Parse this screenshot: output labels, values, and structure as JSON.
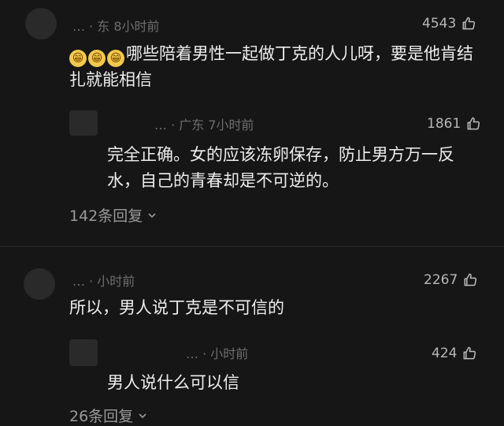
{
  "comments": [
    {
      "meta": "… · 东 8小时前",
      "likes": "4543",
      "emoji_prefix": [
        "😁",
        "😁",
        "😁"
      ],
      "text": "哪些陪着男性一起做丁克的人儿呀，要是他肯结扎就能相信"
    },
    {
      "meta": "… · 广东 7小时前",
      "likes": "1861",
      "text": "完全正确。女的应该冻卵保存，防止男方万一反水，自己的青春却是不可逆的。",
      "replies": "142条回复"
    },
    {
      "meta": "… · 小时前",
      "likes": "2267",
      "text": "所以，男人说丁克是不可信的"
    },
    {
      "meta": "… · 小时前",
      "likes": "424",
      "text": "男人说什么可以信",
      "replies": "26条回复"
    }
  ],
  "icons": {
    "like": "thumbs-up-icon",
    "expand": "chevron-down-icon"
  },
  "colors": {
    "background": "#161616",
    "text": "#eeeeee",
    "meta": "#6e6e6e"
  }
}
